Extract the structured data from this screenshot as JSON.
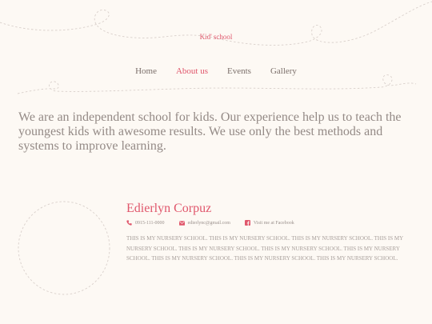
{
  "brand": {
    "name": "Kid' school"
  },
  "nav": {
    "items": [
      {
        "label": "Home"
      },
      {
        "label": "About us"
      },
      {
        "label": "Events"
      },
      {
        "label": "Gallery"
      }
    ],
    "active": "About us"
  },
  "intro": {
    "text": "We are an independent school for kids. Our experience help us to teach the youngest kids with awesome results. We use only the best methods and systems to improve learning."
  },
  "profile": {
    "name": "Edierlyn Corpuz",
    "phone": "0915-111-0000",
    "email": "edierlync@gmail.com",
    "facebook_label": "Visit me at Facebook",
    "bio": "THIS IS MY NURSERY SCHOOL. THIS IS MY NURSERY SCHOOL. THIS IS MY NURSERY SCHOOL. THIS IS MY NURSERY SCHOOL. THIS IS MY NURSERY SCHOOL. THIS IS MY NURSERY SCHOOL. THIS IS MY NURSERY SCHOOL. THIS IS MY NURSERY SCHOOL. THIS IS MY NURSERY SCHOOL. THIS IS MY NURSERY SCHOOL."
  },
  "colors": {
    "background": "#fdf9f4",
    "accent": "#e0576c",
    "text": "#948a86",
    "dashed_line": "#d9d0cb"
  },
  "icons": {
    "phone": "phone-icon",
    "email": "envelope-icon",
    "facebook": "facebook-icon"
  }
}
